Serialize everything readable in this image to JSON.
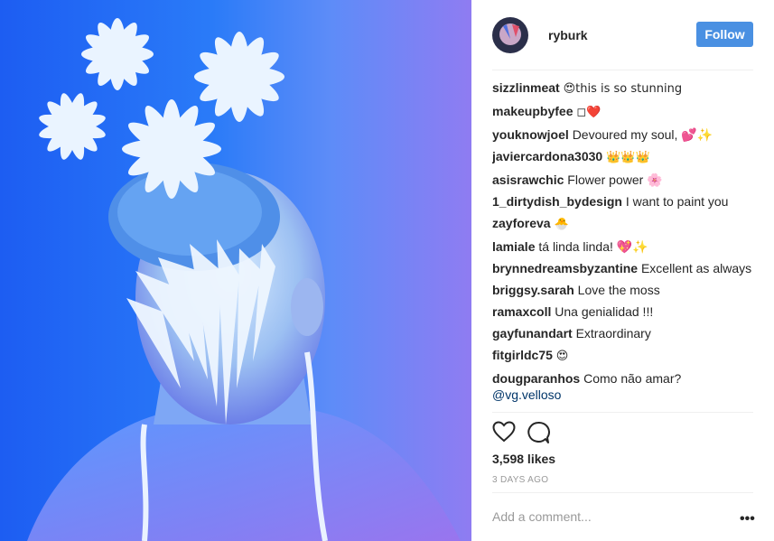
{
  "post": {
    "username": "ryburk",
    "follow_label": "Follow",
    "likes": "3,598 likes",
    "time": "3 DAYS AGO",
    "add_comment_placeholder": "Add a comment...",
    "more_options": "•••"
  },
  "comments": [
    {
      "user": "sizzlinmeat",
      "text": "😍this is so stunning"
    },
    {
      "user": "makeupbyfee",
      "text": "◻❤️"
    },
    {
      "user": "youknowjoel",
      "text": "Devoured my soul, 💕✨"
    },
    {
      "user": "javiercardona3030",
      "text": "👑👑👑"
    },
    {
      "user": "asisrawchic",
      "text": "Flower power 🌸"
    },
    {
      "user": "1_dirtydish_bydesign",
      "text": "I want to paint you"
    },
    {
      "user": "zayforeva",
      "text": "🐣"
    },
    {
      "user": "lamiale",
      "text": "tá linda linda! 💖✨"
    },
    {
      "user": "brynnedreamsbyzantine",
      "text": "Excellent as always"
    },
    {
      "user": "briggsy.sarah",
      "text": "Love the moss"
    },
    {
      "user": "ramaxcoll",
      "text": "Una genialidad !!!"
    },
    {
      "user": "gayfunandart",
      "text": "Extraordinary"
    },
    {
      "user": "fitgirldc75",
      "text": "😍"
    },
    {
      "user": "dougparanhos",
      "text": "Como não amar?",
      "mention": "@vg.velloso"
    }
  ],
  "icons": {
    "like": "heart-icon",
    "comment": "comment-bubble-icon"
  },
  "colors": {
    "follow_button": "#4a90e2",
    "mention": "#003569",
    "muted": "#999999"
  }
}
